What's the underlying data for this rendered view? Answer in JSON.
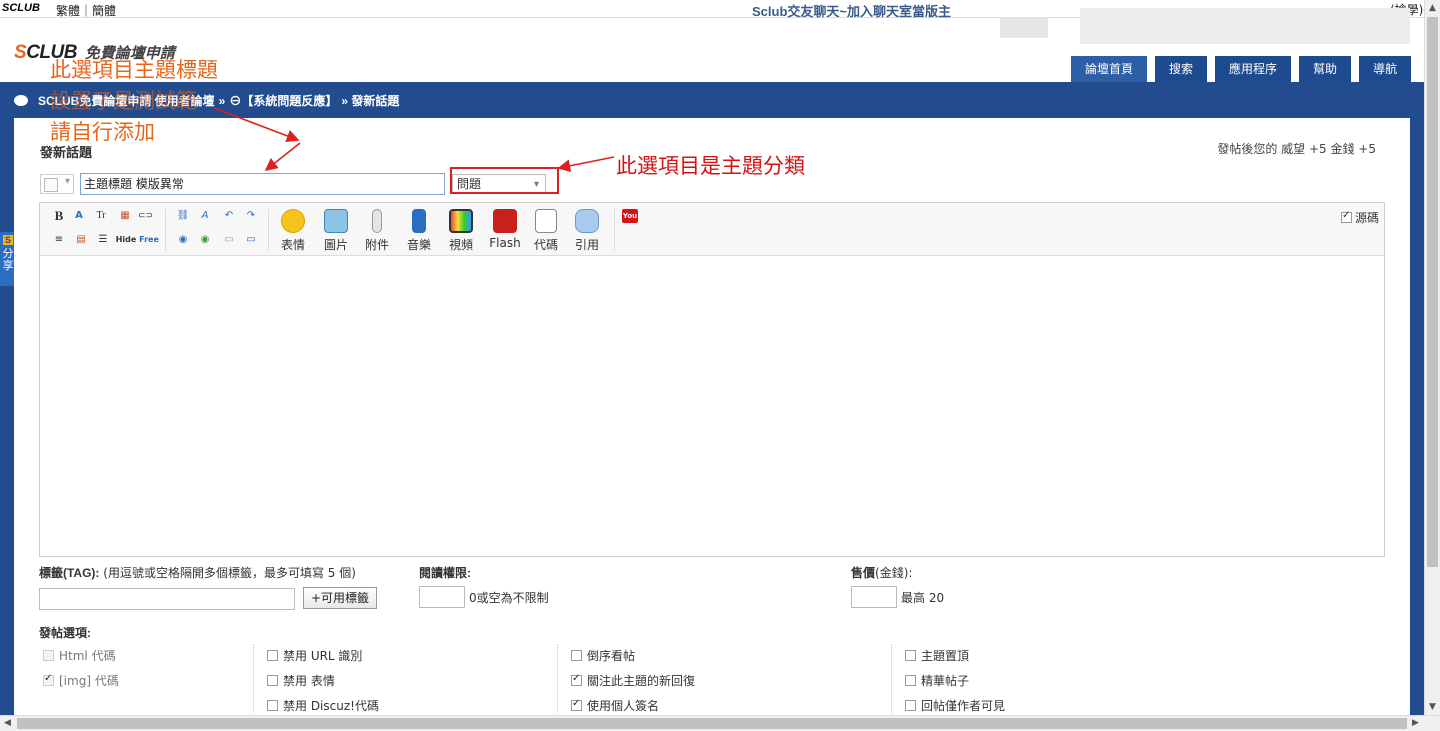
{
  "topbar": {
    "logo_small": "SCLUB",
    "lang": "繁體｜簡體",
    "slogan": "Sclub交友聊天~加入聊天室當版主",
    "corner": "(搶學)"
  },
  "brand": {
    "logo_prefix": "S",
    "logo_rest": "CLUB",
    "subtitle": "免費論壇申請"
  },
  "nav": {
    "tabs": [
      "論壇首頁",
      "搜索",
      "應用程序",
      "幫助",
      "導航"
    ]
  },
  "breadcrumb": {
    "home": "SCLUB免費論壇申請 使用者論壇",
    "sep": "»",
    "section": "⊖【系統問題反應】",
    "current": "» 發新話題"
  },
  "share_tab": {
    "badge": "S",
    "label": "分享"
  },
  "post": {
    "title": "發新話題",
    "reward": "發帖後您的 威望 +5  金錢 +5",
    "subject_value": "主題標題  模版異常",
    "category_value": "問題"
  },
  "editor": {
    "big_buttons": [
      "表情",
      "圖片",
      "附件",
      "音樂",
      "視頻",
      "Flash",
      "代碼",
      "引用"
    ],
    "small_tools_row1": [
      "B",
      "A",
      "Tr",
      "▦",
      "⊂⊃",
      "⛓",
      "A",
      "↶",
      "↷"
    ],
    "small_tools_row2": [
      "≡",
      "▤",
      "☰",
      "Hide",
      "Free",
      "◉",
      "◉",
      "▭",
      "▭"
    ],
    "youtube_label": "You",
    "source_label": "源碼"
  },
  "fields": {
    "tag_label": "標籤(TAG):",
    "tag_hint": "(用逗號或空格隔開多個標籤，最多可填寫 5 個)",
    "tag_button": "+可用標籤",
    "read_label": "閱讀權限:",
    "read_hint": "0或空為不限制",
    "price_label": "售價",
    "price_unit": "(金錢):",
    "price_hint": "最高 20"
  },
  "options": {
    "title": "發帖選項:",
    "col1": [
      {
        "label": "Html 代碼",
        "checked": false,
        "disabled": true
      },
      {
        "label": "[img] 代碼",
        "checked": true,
        "disabled": true
      }
    ],
    "col2": [
      {
        "label": "禁用 URL 識別",
        "checked": false
      },
      {
        "label": "禁用 表情",
        "checked": false
      },
      {
        "label": "禁用 Discuz!代碼",
        "checked": false
      }
    ],
    "col3": [
      {
        "label": "倒序看帖",
        "checked": false
      },
      {
        "label": "關注此主題的新回復",
        "checked": true
      },
      {
        "label": "使用個人簽名",
        "checked": true
      }
    ],
    "col4": [
      {
        "label": "主題置頂",
        "checked": false
      },
      {
        "label": "精華帖子",
        "checked": false
      },
      {
        "label": "回帖僅作者可見",
        "checked": false
      }
    ]
  },
  "annotations": {
    "left_lines": [
      "此選項目主題標題",
      "設置了是測試範",
      "請自行添加"
    ],
    "right": "此選項目是主題分類"
  },
  "colors": {
    "brand_blue": "#234c8e",
    "accent_orange": "#e8661b",
    "annotation_red": "#e02020"
  }
}
